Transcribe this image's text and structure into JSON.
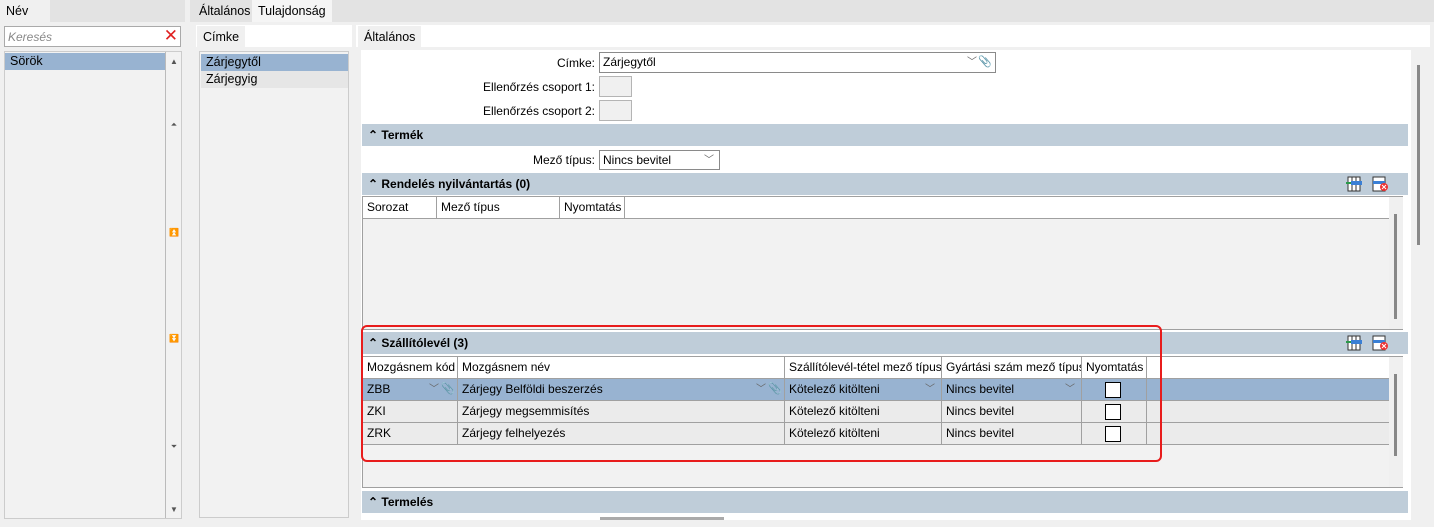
{
  "left": {
    "tab": "Név",
    "search_placeholder": "Keresés",
    "items": [
      "Sörök"
    ]
  },
  "main_tabs": [
    {
      "label": "Általános"
    },
    {
      "label": "Tulajdonság",
      "active": true
    }
  ],
  "cimke_panel": {
    "tab": "Címke",
    "items": [
      "Zárjegytől",
      "Zárjegyig"
    ]
  },
  "detail": {
    "tab": "Általános",
    "cimke_label": "Címke:",
    "cimke_value": "Zárjegytől",
    "csoport1_label": "Ellenőrzés csoport 1:",
    "csoport2_label": "Ellenőrzés csoport 2:",
    "termek": {
      "title": "Termék",
      "mezo_label": "Mező típus:",
      "mezo_value": "Nincs bevitel"
    },
    "rendeles": {
      "title": "Rendelés nyilvántartás (0)",
      "columns": [
        "Sorozat",
        "Mező típus",
        "Nyomtatás"
      ]
    },
    "szallito": {
      "title": "Szállítólevél (3)",
      "columns": [
        "Mozgásnem kód",
        "Mozgásnem név",
        "Szállítólevél-tétel mező típus",
        "Gyártási szám mező típus",
        "Nyomtatás"
      ],
      "rows": [
        {
          "kod": "ZBB",
          "nev": "Zárjegy Belföldi beszerzés",
          "tetel": "Kötelező kitölteni",
          "gyartasi": "Nincs bevitel",
          "nyomtatas": false
        },
        {
          "kod": "ZKI",
          "nev": "Zárjegy megsemmisítés",
          "tetel": "Kötelező kitölteni",
          "gyartasi": "Nincs bevitel",
          "nyomtatas": false
        },
        {
          "kod": "ZRK",
          "nev": "Zárjegy felhelyezés",
          "tetel": "Kötelező kitölteni",
          "gyartasi": "Nincs bevitel",
          "nyomtatas": false
        }
      ]
    },
    "termeles": {
      "title": "Termelés"
    }
  },
  "colors": {
    "selection": "#98b3d1",
    "section_header": "#bfcdd9",
    "highlight": "#e81c1c"
  }
}
